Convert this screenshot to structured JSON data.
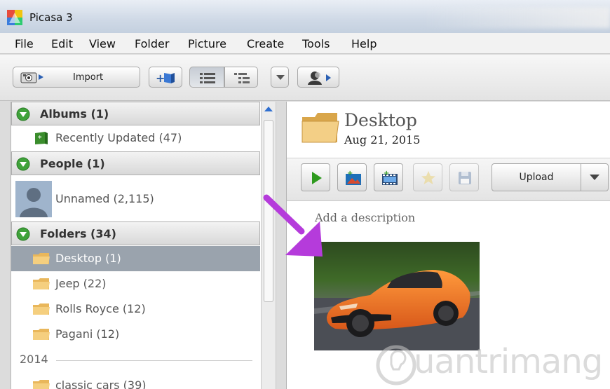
{
  "window": {
    "title": "Picasa 3"
  },
  "menu": [
    "File",
    "Edit",
    "View",
    "Folder",
    "Picture",
    "Create",
    "Tools",
    "Help"
  ],
  "toolbar": {
    "import_label": "Import"
  },
  "library": {
    "albums_header": "Albums (1)",
    "recently_updated": "Recently Updated (47)",
    "people_header": "People (1)",
    "unnamed": "Unnamed (2,115)",
    "folders_header": "Folders (34)",
    "folders": [
      "Desktop (1)",
      "Jeep (22)",
      "Rolls Royce (12)",
      "Pagani (12)"
    ],
    "year": "2014",
    "folders_2014": [
      "classic cars (39)"
    ]
  },
  "folder_view": {
    "title": "Desktop",
    "date": "Aug 21, 2015",
    "upload_label": "Upload",
    "description_placeholder": "Add a description"
  },
  "watermark": {
    "text": "uantrimang"
  },
  "colors": {
    "accent_purple": "#b53bdb",
    "play_green": "#2e9a1e",
    "selected_row": "#9aa3ad"
  }
}
